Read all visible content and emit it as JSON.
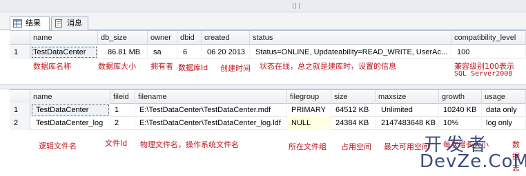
{
  "tabs": [
    {
      "label": "结果"
    },
    {
      "label": "消息"
    }
  ],
  "grid1": {
    "columns": [
      "name",
      "db_size",
      "owner",
      "dbid",
      "created",
      "status",
      "compatibility_level"
    ],
    "rows": [
      {
        "num": "1",
        "cells": [
          "TestDataCenter",
          "86.81 MB",
          "sa",
          "6",
          "06 20 2013",
          "Status=ONLINE, Updateability=READ_WRITE, UserAc...",
          "100"
        ]
      }
    ]
  },
  "annotations1": {
    "name": "数据库名称",
    "db_size": "数据库大小",
    "owner": "拥有者",
    "dbid": "数据库Id",
    "created": "创建时间",
    "status": "状态在线，总之就是建库时，设置的信息",
    "compat_line1": "兼容级别100表示",
    "compat_line2": "SQL Server2008"
  },
  "grid2": {
    "columns": [
      "name",
      "fileid",
      "filename",
      "filegroup",
      "size",
      "maxsize",
      "growth",
      "usage"
    ],
    "rows": [
      {
        "num": "1",
        "cells": [
          "TestDataCenter",
          "1",
          "E:\\TestDataCenter\\TestDataCenter.mdf",
          "PRIMARY",
          "64512 KB",
          "Unlimited",
          "10240 KB",
          "data only"
        ]
      },
      {
        "num": "2",
        "cells": [
          "TestDataCenter_log",
          "2",
          "E:\\TestDataCenter\\TestDataCenter_log.ldf",
          "NULL",
          "24384 KB",
          "2147483648 KB",
          "10%",
          "log only"
        ]
      }
    ]
  },
  "annotations2": {
    "name": "逻辑文件名",
    "fileid": "文件Id",
    "filename": "物理文件名，操作系统文件名",
    "filegroup": "所在文件组",
    "size": "占用空间",
    "maxsize": "最大可用空间",
    "growth": "每次增长大小",
    "usage_line1": "数",
    "usage_line2": "据",
    "usage_line3": "志"
  },
  "watermark": {
    "cn": "开发者",
    "en": "DevZe.CoM"
  },
  "colors": {
    "annotation": "#c0141b",
    "watermark": "#2b3f73",
    "header_bg": "#eceef1"
  }
}
